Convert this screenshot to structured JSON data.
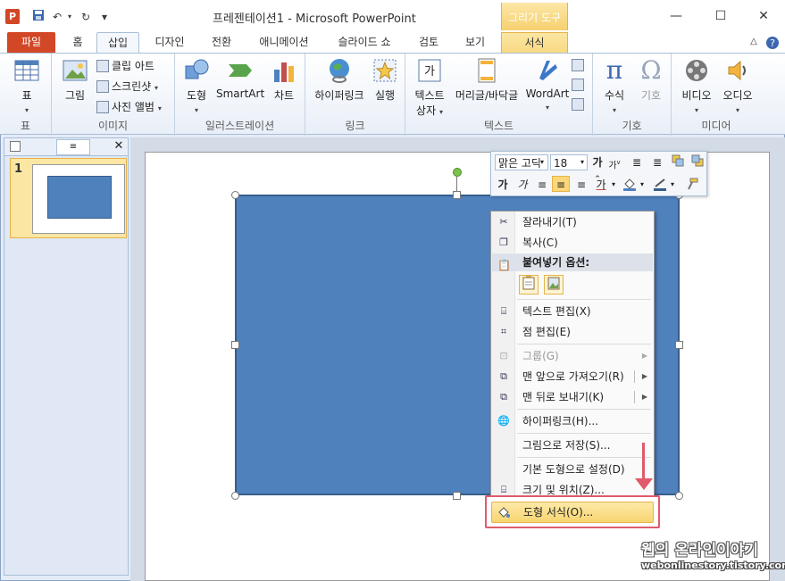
{
  "window": {
    "app_icon": "P",
    "title": "프레젠테이션1  -  Microsoft PowerPoint",
    "context_group": "그리기 도구",
    "qat": {
      "save_icon": "save-icon",
      "undo": "↶",
      "redo": "↻",
      "customize": "▾"
    },
    "controls": {
      "minimize": "—",
      "maximize": "☐",
      "close": "✕"
    }
  },
  "tabs": [
    {
      "label": "파일"
    },
    {
      "label": "홈"
    },
    {
      "label": "삽입"
    },
    {
      "label": "디자인"
    },
    {
      "label": "전환"
    },
    {
      "label": "애니메이션"
    },
    {
      "label": "슬라이드 쇼"
    },
    {
      "label": "검토"
    },
    {
      "label": "보기"
    },
    {
      "label": "서식"
    }
  ],
  "ribbon": {
    "groups": {
      "table": "표",
      "image": "이미지",
      "illustration": "일러스트레이션",
      "link": "링크",
      "text": "텍스트",
      "symbol": "기호",
      "media": "미디어"
    },
    "buttons": {
      "table": "표",
      "picture": "그림",
      "clipart": "클립 아트",
      "screenshot": "스크린샷",
      "photo_album": "사진 앨범",
      "shapes": "도형",
      "smartart": "SmartArt",
      "chart": "차트",
      "hyperlink": "하이퍼링크",
      "action": "실행",
      "textbox_line1": "텍스트",
      "textbox_line2": "상자",
      "header_footer": "머리글/바닥글",
      "wordart": "WordArt",
      "equation": "수식",
      "symbol": "기호",
      "video": "비디오",
      "audio": "오디오"
    }
  },
  "slide_panel": {
    "slide_number": "1"
  },
  "mini_toolbar": {
    "font": "맑은 고딕",
    "size": "18"
  },
  "context_menu": {
    "items": {
      "cut": "잘라내기(T)",
      "copy": "복사(C)",
      "paste_options": "붙여넣기 옵션:",
      "edit_text": "텍스트 편집(X)",
      "edit_points": "점 편집(E)",
      "group": "그룹(G)",
      "bring_front": "맨 앞으로 가져오기(R)",
      "send_back": "맨 뒤로 보내기(K)",
      "hyperlink": "하이퍼링크(H)...",
      "save_as_picture": "그림으로 저장(S)...",
      "set_default": "기본 도형으로 설정(D)",
      "size_position": "크기 및 위치(Z)...",
      "format_shape": "도형 서식(O)..."
    }
  },
  "watermark": {
    "title": "웹의 온라인이야기",
    "url": "webonlinestory.tistory.com"
  },
  "colors": {
    "file_tab": "#d24726",
    "shape_fill": "#4f81bd",
    "highlight": "#f8d571",
    "annotation": "#e05a6b"
  }
}
